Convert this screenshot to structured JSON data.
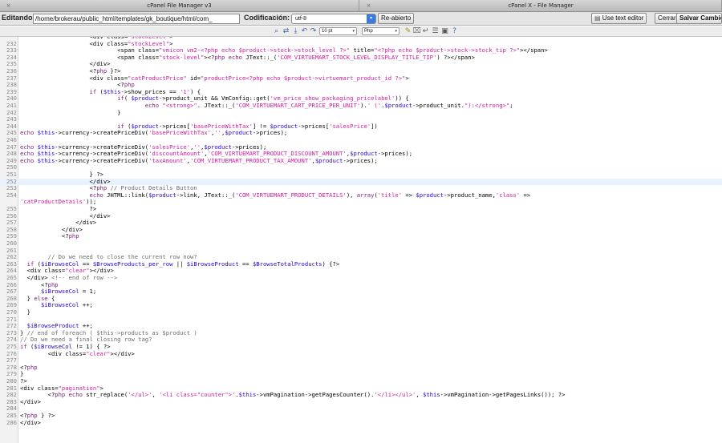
{
  "tabs": [
    {
      "label": "cPanel File Manager v3"
    },
    {
      "label": "cPanel X - File Manager"
    }
  ],
  "topbar": {
    "editing_label": "Editando:",
    "path_value": "/home/brokerau/public_html/templates/gk_boutique/html/com_",
    "encoding_label": "Codificación:",
    "encoding_value": "utf-8",
    "reopen_label": "Re-abierto",
    "use_text_editor_label": "Use text editor",
    "close_label": "Cerrar",
    "save_label": "Salvar Cambios"
  },
  "toolbar": {
    "icons": [
      "search-icon",
      "search-replace-icon",
      "goto-line-icon",
      "undo-icon",
      "redo-icon",
      "fullscreen-icon"
    ],
    "font_size_value": "10 pt",
    "syntax_value": "Php",
    "tool_icons": [
      "highlight-toggle-icon",
      "reset-highlight-icon",
      "word-wrap-icon",
      "editor-settings-icon",
      "help-icon"
    ]
  },
  "editor": {
    "active_line": 252,
    "lines": [
      {
        "n": "",
        "code": "                    <div class=\"stockLevel\">"
      },
      {
        "n": "232",
        "code": "                    <div class=\"stockLevel\">"
      },
      {
        "n": "233",
        "code": "                            <span class=\"vmicon vm2-<?php echo $product->stock->stock_level ?>\" title=\"<?php echo $product->stock->stock_tip ?>\"></span>"
      },
      {
        "n": "234",
        "code": "                            <span class=\"stock-level\"><?php echo JText::_('COM_VIRTUEMART_STOCK_LEVEL_DISPLAY_TITLE_TIP') ?></span>"
      },
      {
        "n": "235",
        "code": "                    </div>"
      },
      {
        "n": "236",
        "code": "                    <?php }?>"
      },
      {
        "n": "237",
        "code": "                    <div class=\"catProductPrice\" id=\"productPrice<?php echo $product->virtuemart_product_id ?>\">"
      },
      {
        "n": "238",
        "code": "                            <?php"
      },
      {
        "n": "239",
        "code": "                    if ($this->show_prices == '1') {"
      },
      {
        "n": "240",
        "code": "                            if( $product->product_unit && VmConfig::get('vm_price_show_packaging_pricelabel')) {"
      },
      {
        "n": "241",
        "code": "                                    echo \"<strong>\". JText::_('COM_VIRTUEMART_CART_PRICE_PER_UNIT').' ('.$product->product_unit.\"):</strong>\";"
      },
      {
        "n": "242",
        "code": "                            }"
      },
      {
        "n": "243",
        "code": ""
      },
      {
        "n": "244",
        "code": "                            if ($product->prices['basePriceWithTax'] != $product->prices['salesPrice'])"
      },
      {
        "n": "245",
        "code": "echo $this->currency->createPriceDiv('basePriceWithTax','',$product->prices);"
      },
      {
        "n": "246",
        "code": ""
      },
      {
        "n": "247",
        "code": "echo $this->currency->createPriceDiv('salesPrice','',$product->prices);"
      },
      {
        "n": "248",
        "code": "echo $this->currency->createPriceDiv('discountAmount','COM_VIRTUEMART_PRODUCT_DISCOUNT_AMOUNT',$product->prices);"
      },
      {
        "n": "249",
        "code": "echo $this->currency->createPriceDiv('taxAmount','COM_VIRTUEMART_PRODUCT_TAX_AMOUNT',$product->prices);"
      },
      {
        "n": "250",
        "code": ""
      },
      {
        "n": "251",
        "code": "                    } ?>"
      },
      {
        "n": "252",
        "code": "                    </div>"
      },
      {
        "n": "253",
        "code": "                    <?php // Product Details Button"
      },
      {
        "n": "254",
        "code": "                    echo JHTML::link($product->link, JText::_('COM_VIRTUEMART_PRODUCT_DETAILS'), array('title' => $product->product_name,'class' =>"
      },
      {
        "n": "",
        "code": "'catProductDetails'));"
      },
      {
        "n": "255",
        "code": "                    ?>"
      },
      {
        "n": "256",
        "code": "                    </div>"
      },
      {
        "n": "257",
        "code": "                </div>"
      },
      {
        "n": "258",
        "code": "            </div>"
      },
      {
        "n": "259",
        "code": "            <?php"
      },
      {
        "n": "260",
        "code": ""
      },
      {
        "n": "261",
        "code": ""
      },
      {
        "n": "262",
        "code": "        // Do we need to close the current row now?"
      },
      {
        "n": "263",
        "code": "  if ($iBrowseCol == $BrowseProducts_per_row || $iBrowseProduct == $BrowseTotalProducts) {?>"
      },
      {
        "n": "264",
        "code": "  <div class=\"clear\"></div>"
      },
      {
        "n": "265",
        "code": "  </div> <!-- end of row -->"
      },
      {
        "n": "266",
        "code": "      <?php"
      },
      {
        "n": "267",
        "code": "      $iBrowseCol = 1;"
      },
      {
        "n": "268",
        "code": "  } else {"
      },
      {
        "n": "269",
        "code": "      $iBrowseCol ++;"
      },
      {
        "n": "270",
        "code": "  }"
      },
      {
        "n": "271",
        "code": ""
      },
      {
        "n": "272",
        "code": "  $iBrowseProduct ++;"
      },
      {
        "n": "273",
        "code": "} // end of foreach ( $this->products as $product )"
      },
      {
        "n": "274",
        "code": "// Do we need a final closing row tag?"
      },
      {
        "n": "275",
        "code": "if ($iBrowseCol != 1) { ?>"
      },
      {
        "n": "276",
        "code": "        <div class=\"clear\"></div>"
      },
      {
        "n": "277",
        "code": ""
      },
      {
        "n": "278",
        "code": "<?php"
      },
      {
        "n": "279",
        "code": "}"
      },
      {
        "n": "280",
        "code": "?>"
      },
      {
        "n": "281",
        "code": "<div class=\"pagination\">"
      },
      {
        "n": "282",
        "code": "        <?php echo str_replace('</ul>', '<li class=\"counter\">'.$this->vmPagination->getPagesCounter().'</li></ul>', $this->vmPagination->getPagesLinks()); ?>"
      },
      {
        "n": "283",
        "code": "</div>"
      },
      {
        "n": "284",
        "code": ""
      },
      {
        "n": "285",
        "code": "<?php } ?>"
      },
      {
        "n": "286",
        "code": "</div>"
      }
    ]
  }
}
